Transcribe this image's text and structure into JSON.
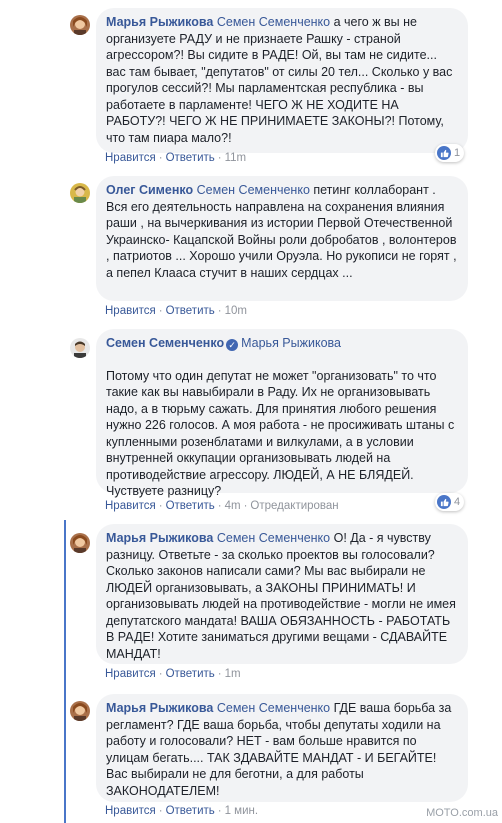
{
  "comments": [
    {
      "author": "Марья Рыжикова",
      "mention": "Семен Семенченко",
      "text": " а чего ж вы не организуете РАДУ и не признаете Рашку - страной агрессором?! Вы сидите в РАДЕ! Ой, вы там не сидите... вас там бывает, \"депутатов\" от силы 20 тел... Сколько у вас прогулов сессий?! Мы парламентская республика - вы работаете в парламенте! ЧЕГО Ж НЕ ХОДИТЕ НА РАБОТУ?! ЧЕГО Ж НЕ ПРИНИМАЕТЕ ЗАКОНЫ?! Потому, что там пиара мало?!",
      "like": "Нравится",
      "reply": "Ответить",
      "time": "11m",
      "reactions": "1"
    },
    {
      "author": "Олег Сименко",
      "mention": "Семен Семенченко",
      "text": " петинг коллаборант . Вся его деятельность направлена на сохранения влияния раши , на вычеркивания из истории Первой Отечественной Украинско- Кацапской Войны роли добробатов , волонтеров , патриотов ... Хорошо учили Оруэла. Но рукописи не горят , а пепел Клааса стучит в наших сердцах ...",
      "like": "Нравится",
      "reply": "Ответить",
      "time": "10m"
    },
    {
      "author": "Семен Семенченко",
      "mention": "Марья Рыжикова",
      "text": "Потому что один депутат не может \"организовать\" то что такие как вы навыбирали в Раду. Их не организовывать надо, а в тюрьму сажать. Для принятия любого решения нужно 226 голосов. А моя работа - не просиживать штаны с купленными розенблатами и вилкулами, а в условии внутренней оккупации организовывать людей на противодействие агрессору. ЛЮДЕЙ, А НЕ БЛЯДЕЙ. Чуствуете разницу?",
      "like": "Нравится",
      "reply": "Ответить",
      "time": "4m",
      "edited": "Отредактирован",
      "reactions": "4"
    },
    {
      "author": "Марья Рыжикова",
      "mention": "Семен Семенченко",
      "text": " О! Да - я чувству разницу. Ответьте - за сколько проектов вы голосовали? Сколько законов написали сами? Мы вас выбирали не ЛЮДЕЙ организовывать, а ЗАКОНЫ ПРИНИМАТЬ! И организовывать людей на противодействие - могли не имея депутатского мандата! ВАША ОБЯЗАННОСТЬ - РАБОТАТЬ В РАДЕ! Хотите заниматься другими вещами - СДАВАЙТЕ МАНДАТ!",
      "like": "Нравится",
      "reply": "Ответить",
      "time": "1m"
    },
    {
      "author": "Марья Рыжикова",
      "mention": "Семен Семенченко",
      "text": " ГДЕ ваша борьба за регламент? ГДЕ ваша борьба, чтобы депутаты ходили на работу и голосовали? НЕТ - вам больше нравится по улицам бегать.... ТАК ЗДАВАЙТЕ МАНДАТ - И БЕГАЙТЕ! Вас выбирали не для беготни, а для работы ЗАКОНОДАТЕЛЕМ!",
      "like": "Нравится",
      "reply": "Ответить",
      "time": "1 мин."
    }
  ],
  "watermark": "MOTO.com.ua",
  "colors": {
    "name": "#385898",
    "bubble": "#f2f3f5",
    "like": "#4a76c8",
    "meta": "#90949c"
  }
}
